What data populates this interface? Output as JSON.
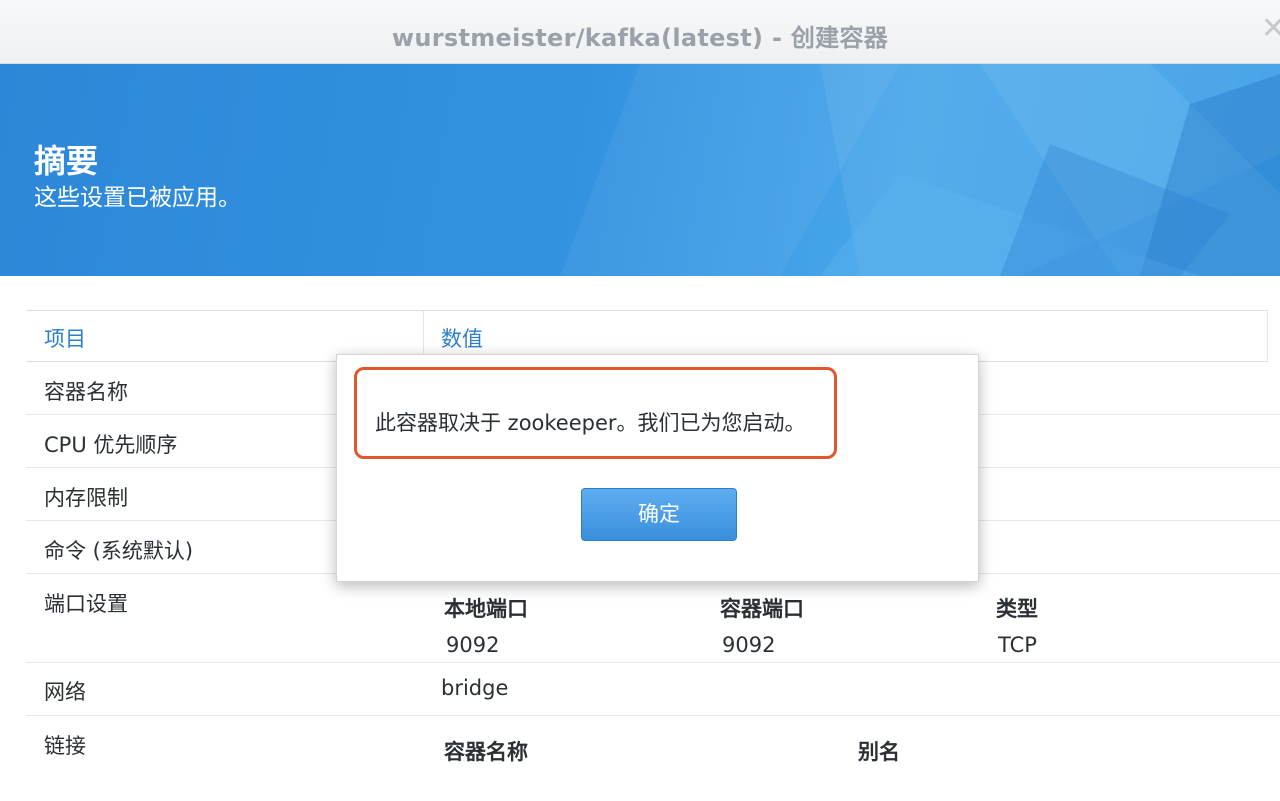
{
  "window": {
    "title": "wurstmeister/kafka(latest) - 创建容器",
    "close_glyph": "✕"
  },
  "banner": {
    "heading": "摘要",
    "subheading": "这些设置已被应用。"
  },
  "table": {
    "headers": {
      "item": "项目",
      "value": "数值"
    },
    "rows": {
      "container_name": "容器名称",
      "cpu_priority": "CPU 优先顺序",
      "memory_limit": "内存限制",
      "command": "命令 (系统默认)",
      "port_settings": "端口设置",
      "network": "网络",
      "links": "链接"
    },
    "ports": {
      "local_header": "本地端口",
      "container_header": "容器端口",
      "type_header": "类型",
      "local_value": "9092",
      "container_value": "9092",
      "type_value": "TCP"
    },
    "network_value": "bridge",
    "links_sub": {
      "container_name": "容器名称",
      "alias": "别名"
    }
  },
  "dialog": {
    "message": "此容器取决于 zookeeper。我们已为您启动。",
    "ok_label": "确定"
  },
  "colors": {
    "banner_blue": "#3392e0",
    "header_text_blue": "#2e7fcb",
    "highlight_border": "#e0562d",
    "button_blue": "#3a8fdc"
  }
}
